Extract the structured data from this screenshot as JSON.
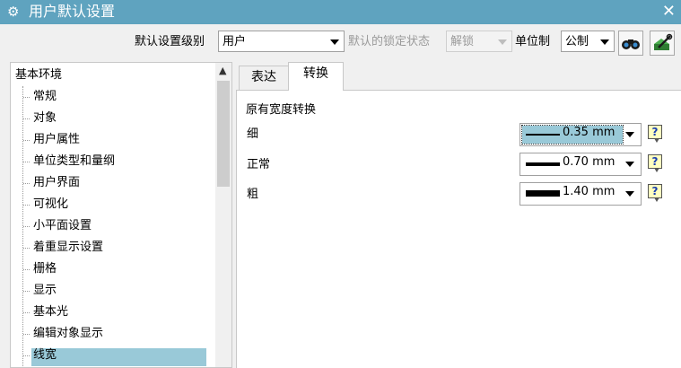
{
  "window": {
    "title": "用户默认设置",
    "close_glyph": "✕",
    "settings_glyph": "⚙"
  },
  "toolbar": {
    "level_label": "默认设置级别",
    "level_value": "用户",
    "lock_label": "默认的锁定状态",
    "lock_value": "解锁",
    "unit_label": "单位制",
    "unit_value": "公制",
    "search_icon": "binoculars-icon",
    "manager_icon": "settings-manager-icon"
  },
  "tree": {
    "root": "基本环境",
    "scroll_up_glyph": "▲",
    "items": [
      "常规",
      "对象",
      "用户属性",
      "单位类型和量纲",
      "用户界面",
      "可视化",
      "小平面设置",
      "着重显示设置",
      "栅格",
      "显示",
      "基本光",
      "编辑对象显示",
      "线宽"
    ],
    "selected_item": "线宽"
  },
  "tabs": [
    "表达",
    "转换"
  ],
  "active_tab": "转换",
  "panel": {
    "group_title": "原有宽度转换",
    "rows": [
      {
        "label": "细",
        "value": "0.35 mm"
      },
      {
        "label": "正常",
        "value": "0.70 mm"
      },
      {
        "label": "粗",
        "value": "1.40 mm"
      }
    ],
    "help_glyph": "?"
  },
  "colors": {
    "titlebar": "#5fa3bf",
    "selection": "#99c9d8",
    "help_bg": "#ffffc0"
  }
}
